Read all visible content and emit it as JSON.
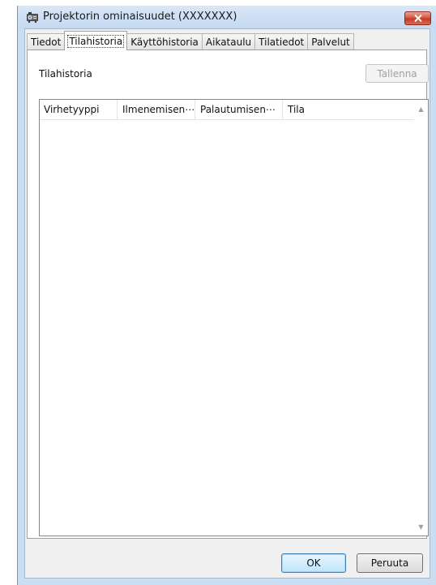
{
  "window": {
    "title": "Projektorin ominaisuudet (XXXXXXX)",
    "icon": "projector-icon",
    "close_icon": "close-icon"
  },
  "tabs": [
    {
      "label": "Tiedot",
      "active": false
    },
    {
      "label": "Tilahistoria",
      "active": true
    },
    {
      "label": "Käyttöhistoria",
      "active": false
    },
    {
      "label": "Aikataulu",
      "active": false
    },
    {
      "label": "Tilatiedot",
      "active": false
    },
    {
      "label": "Palvelut",
      "active": false
    }
  ],
  "panel": {
    "section_label": "Tilahistoria",
    "save_label": "Tallenna",
    "columns": [
      "Virhetyyppi",
      "Ilmenemisen⋯",
      "Palautumisen⋯",
      "Tila"
    ],
    "rows": []
  },
  "footer": {
    "ok_label": "OK",
    "cancel_label": "Peruuta"
  },
  "colors": {
    "close_button": "#c23a24",
    "titlebar": "#c4d9f1"
  }
}
